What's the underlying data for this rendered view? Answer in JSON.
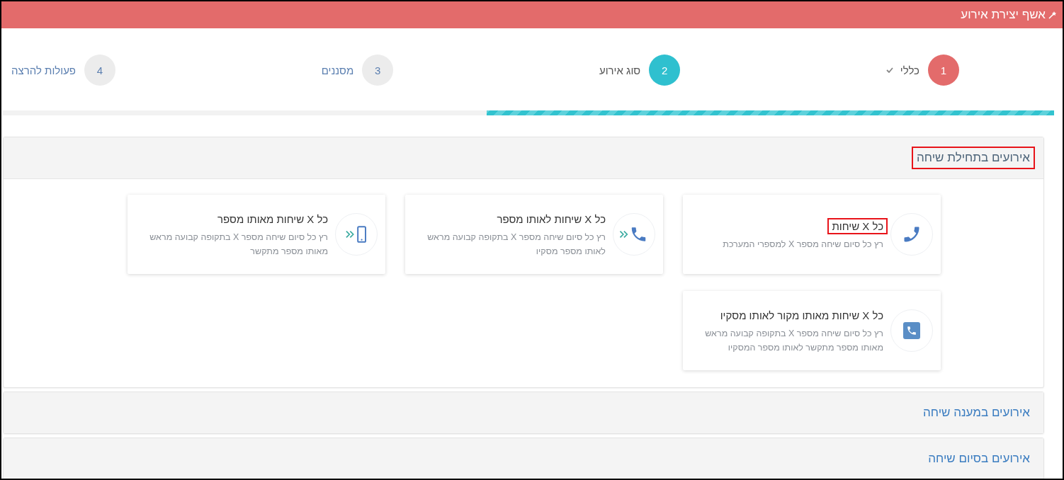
{
  "header": {
    "title": "אשף יצירת אירוע"
  },
  "steps": [
    {
      "number": "1",
      "label": "כללי",
      "completed": true,
      "selected": false
    },
    {
      "number": "2",
      "label": "סוג אירוע",
      "completed": false,
      "selected": true
    },
    {
      "number": "3",
      "label": "מסננים",
      "completed": false,
      "selected": false
    },
    {
      "number": "4",
      "label": "פעולות להרצה",
      "completed": false,
      "selected": false
    }
  ],
  "progress": {
    "level": 0.54
  },
  "panels": [
    {
      "title": "אירועים בתחילת שיחה",
      "expanded": true,
      "highlighted": true,
      "cards": [
        {
          "kind": "phone",
          "title": "כל X שיחות",
          "highlighted": true,
          "description": "רץ כל סיום שיחה מספר X למספרי המערכת"
        },
        {
          "kind": "phone-forward",
          "title": "כל X שיחות לאותו מספר",
          "highlighted": false,
          "description": "רץ כל סיום שיחה מספר X בתקופה קבועה מראש לאותו מספר מסקיו"
        },
        {
          "kind": "mobile-forward",
          "title": "כל X שיחות מאותו מספר",
          "highlighted": false,
          "description": "רץ כל סיום שיחה מספר X בתקופה קבועה מראש מאותו מספר מתקשר"
        },
        {
          "kind": "phone-square",
          "title": "כל X שיחות מאותו מקור לאותו מסקיו",
          "highlighted": false,
          "description": "רץ כל סיום שיחה מספר X בתקופה קבועה מראש מאותו מספר מתקשר לאותו מספר המסקיו"
        }
      ]
    },
    {
      "title": "אירועים במענה שיחה",
      "expanded": false,
      "highlighted": false
    },
    {
      "title": "אירועים בסיום שיחה",
      "expanded": false,
      "highlighted": false
    }
  ]
}
